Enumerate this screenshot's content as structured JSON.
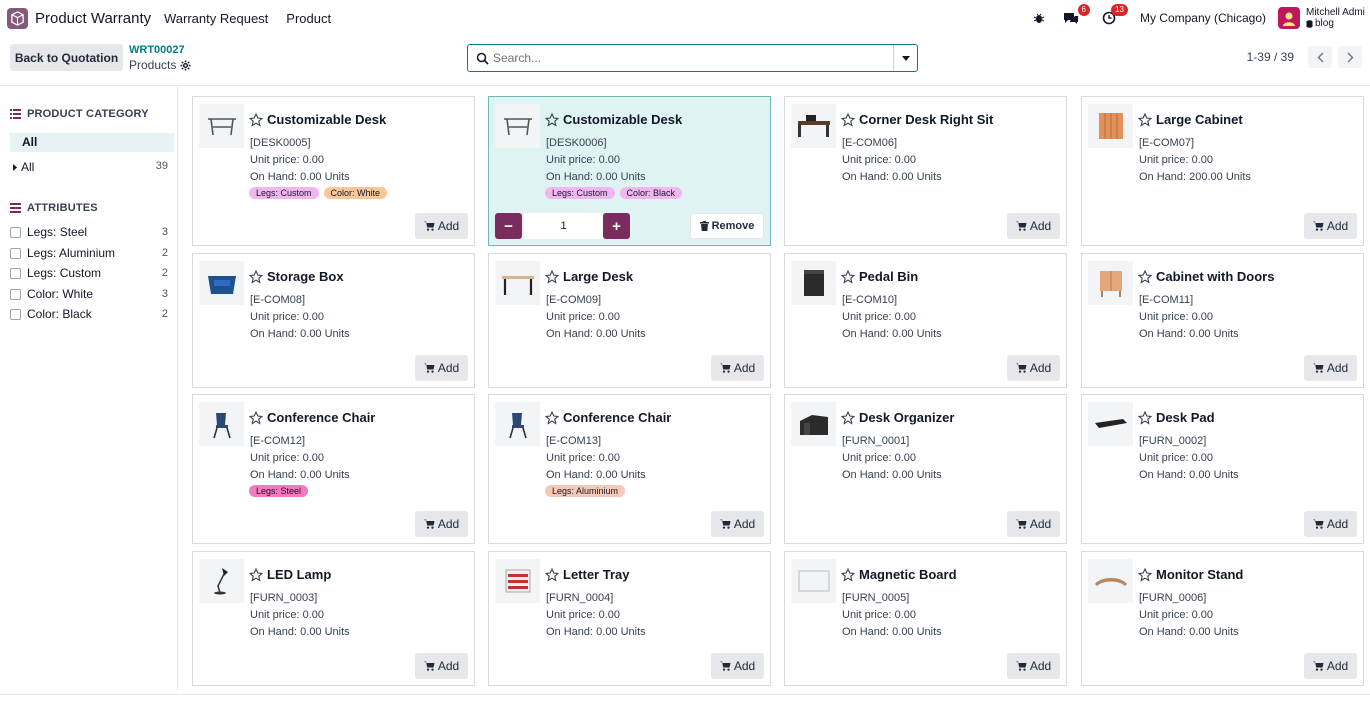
{
  "app": {
    "name": "Product Warranty",
    "menu": [
      "Warranty Request",
      "Product"
    ]
  },
  "navbar": {
    "messages_count": "6",
    "activities_count": "13",
    "company": "My Company (Chicago)",
    "user_name": "Mitchell Admi",
    "user_db": "blog"
  },
  "control": {
    "back_label": "Back to Quotation",
    "record_code": "WRT00027",
    "title": "Products",
    "search_placeholder": "Search...",
    "pager": "1-39 / 39"
  },
  "sidebar": {
    "category_heading": "PRODUCT CATEGORY",
    "active_category": "All",
    "category_all": {
      "label": "All",
      "count": "39"
    },
    "attributes_heading": "ATTRIBUTES",
    "attributes": [
      {
        "label": "Legs: Steel",
        "count": "3"
      },
      {
        "label": "Legs: Aluminium",
        "count": "2"
      },
      {
        "label": "Legs: Custom",
        "count": "2"
      },
      {
        "label": "Color: White",
        "count": "3"
      },
      {
        "label": "Color: Black",
        "count": "2"
      }
    ]
  },
  "labels": {
    "add": "Add",
    "remove": "Remove",
    "minus": "−",
    "plus": "+",
    "qty": "1"
  },
  "tag_colors": {
    "Legs: Custom": "#f0b7ef",
    "Color: White": "#f7c699",
    "Color: Black": "#f0b7ef",
    "Legs: Steel": "#f17ac0",
    "Legs: Aluminium": "#f7c8b5"
  },
  "products": [
    {
      "name": "Customizable Desk",
      "ref": "[DESK0005]",
      "price": "Unit price: 0.00",
      "onhand": "On Hand: 0.00 Units",
      "tags": [
        "Legs: Custom",
        "Color: White"
      ],
      "icon": "desk-icon",
      "selected": false
    },
    {
      "name": "Customizable Desk",
      "ref": "[DESK0006]",
      "price": "Unit price: 0.00",
      "onhand": "On Hand: 0.00 Units",
      "tags": [
        "Legs: Custom",
        "Color: Black"
      ],
      "icon": "desk-icon",
      "selected": true
    },
    {
      "name": "Corner Desk Right Sit",
      "ref": "[E-COM06]",
      "price": "Unit price: 0.00",
      "onhand": "On Hand: 0.00 Units",
      "tags": [],
      "icon": "corner-desk-icon",
      "selected": false
    },
    {
      "name": "Large Cabinet",
      "ref": "[E-COM07]",
      "price": "Unit price: 0.00",
      "onhand": "On Hand: 200.00 Units",
      "tags": [],
      "icon": "cabinet-icon",
      "selected": false
    },
    {
      "name": "Storage Box",
      "ref": "[E-COM08]",
      "price": "Unit price: 0.00",
      "onhand": "On Hand: 0.00 Units",
      "tags": [],
      "icon": "storage-box-icon",
      "selected": false
    },
    {
      "name": "Large Desk",
      "ref": "[E-COM09]",
      "price": "Unit price: 0.00",
      "onhand": "On Hand: 0.00 Units",
      "tags": [],
      "icon": "large-desk-icon",
      "selected": false
    },
    {
      "name": "Pedal Bin",
      "ref": "[E-COM10]",
      "price": "Unit price: 0.00",
      "onhand": "On Hand: 0.00 Units",
      "tags": [],
      "icon": "pedal-bin-icon",
      "selected": false
    },
    {
      "name": "Cabinet with Doors",
      "ref": "[E-COM11]",
      "price": "Unit price: 0.00",
      "onhand": "On Hand: 0.00 Units",
      "tags": [],
      "icon": "cabinet-doors-icon",
      "selected": false
    },
    {
      "name": "Conference Chair",
      "ref": "[E-COM12]",
      "price": "Unit price: 0.00",
      "onhand": "On Hand: 0.00 Units",
      "tags": [
        "Legs: Steel"
      ],
      "icon": "chair-icon",
      "selected": false
    },
    {
      "name": "Conference Chair",
      "ref": "[E-COM13]",
      "price": "Unit price: 0.00",
      "onhand": "On Hand: 0.00 Units",
      "tags": [
        "Legs: Aluminium"
      ],
      "icon": "chair-icon",
      "selected": false
    },
    {
      "name": "Desk Organizer",
      "ref": "[FURN_0001]",
      "price": "Unit price: 0.00",
      "onhand": "On Hand: 0.00 Units",
      "tags": [],
      "icon": "organizer-icon",
      "selected": false
    },
    {
      "name": "Desk Pad",
      "ref": "[FURN_0002]",
      "price": "Unit price: 0.00",
      "onhand": "On Hand: 0.00 Units",
      "tags": [],
      "icon": "desk-pad-icon",
      "selected": false
    },
    {
      "name": "LED Lamp",
      "ref": "[FURN_0003]",
      "price": "Unit price: 0.00",
      "onhand": "On Hand: 0.00 Units",
      "tags": [],
      "icon": "lamp-icon",
      "selected": false
    },
    {
      "name": "Letter Tray",
      "ref": "[FURN_0004]",
      "price": "Unit price: 0.00",
      "onhand": "On Hand: 0.00 Units",
      "tags": [],
      "icon": "letter-tray-icon",
      "selected": false
    },
    {
      "name": "Magnetic Board",
      "ref": "[FURN_0005]",
      "price": "Unit price: 0.00",
      "onhand": "On Hand: 0.00 Units",
      "tags": [],
      "icon": "board-icon",
      "selected": false
    },
    {
      "name": "Monitor Stand",
      "ref": "[FURN_0006]",
      "price": "Unit price: 0.00",
      "onhand": "On Hand: 0.00 Units",
      "tags": [],
      "icon": "monitor-stand-icon",
      "selected": false
    }
  ]
}
